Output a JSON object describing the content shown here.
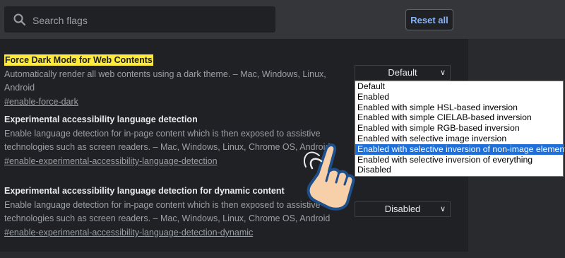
{
  "search": {
    "placeholder": "Search flags",
    "icon": "search-icon"
  },
  "header": {
    "reset_label": "Reset all"
  },
  "flags": [
    {
      "title": "Force Dark Mode for Web Contents",
      "description": "Automatically render all web contents using a dark theme. – Mac, Windows, Linux, Android",
      "link": "#enable-force-dark",
      "select_value": "Default"
    },
    {
      "title": "Experimental accessibility language detection",
      "description": "Enable language detection for in-page content which is then exposed to assistive technologies such as screen readers. – Mac, Windows, Linux, Chrome OS, Android",
      "link": "#enable-experimental-accessibility-language-detection"
    },
    {
      "title": "Experimental accessibility language detection for dynamic content",
      "description": "Enable language detection for in-page content which is then exposed to assistive technologies such as screen readers. – Mac, Windows, Linux, Chrome OS, Android",
      "link": "#enable-experimental-accessibility-language-detection-dynamic",
      "select_value": "Disabled"
    }
  ],
  "dropdown": {
    "options": [
      "Default",
      "Enabled",
      "Enabled with simple HSL-based inversion",
      "Enabled with simple CIELAB-based inversion",
      "Enabled with simple RGB-based inversion",
      "Enabled with selective image inversion",
      "Enabled with selective inversion of non-image elements",
      "Enabled with selective inversion of everything",
      "Disabled"
    ],
    "selected": "Enabled with selective inversion of non-image elements"
  },
  "colors": {
    "accent": "#8ab4f8",
    "highlight": "#ffeb3b",
    "selection": "#1e6fd9",
    "background": "#202124"
  }
}
